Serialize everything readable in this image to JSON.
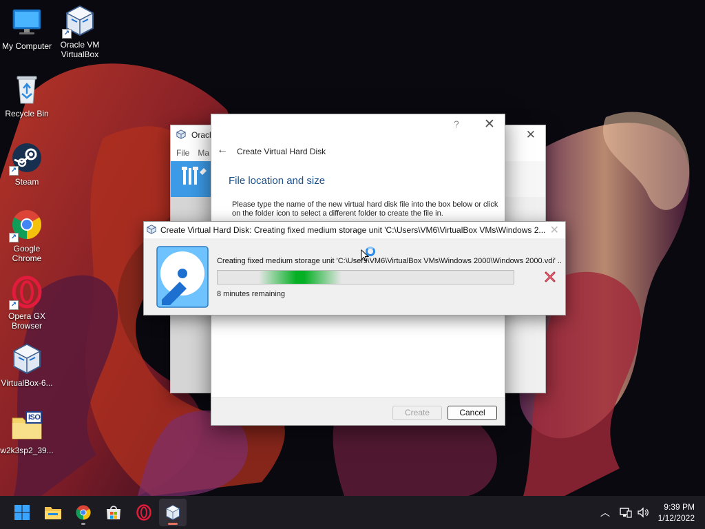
{
  "desktop": {
    "icons": [
      {
        "label": "My Computer",
        "icon": "monitor-icon"
      },
      {
        "label": "Oracle VM VirtualBox",
        "icon": "virtualbox-icon"
      },
      {
        "label": "Recycle Bin",
        "icon": "recycle-bin-icon"
      },
      {
        "label": "Steam",
        "icon": "steam-icon"
      },
      {
        "label": "Google Chrome",
        "icon": "chrome-icon"
      },
      {
        "label": "Opera GX Browser",
        "icon": "opera-gx-icon"
      },
      {
        "label": "VirtualBox-6...",
        "icon": "virtualbox-installer-icon"
      },
      {
        "label": "w2k3sp2_39...",
        "icon": "iso-folder-icon"
      }
    ],
    "iso_badge": "ISO"
  },
  "vbox_main": {
    "title": "Oracle",
    "menu": [
      "File",
      "Ma"
    ]
  },
  "wizard": {
    "help": "?",
    "header": "Create Virtual Hard Disk",
    "subtitle": "File location and size",
    "paragraph": "Please type the name of the new virtual hard disk file into the box below or click on the folder icon to select a different folder to create the file in.",
    "create_label": "Create",
    "cancel_label": "Cancel"
  },
  "progress": {
    "title": "Create Virtual Hard Disk: Creating fixed medium storage unit 'C:\\Users\\VM6\\VirtualBox VMs\\Windows 2...",
    "description": "Creating fixed medium storage unit 'C:\\Users\\VM6\\VirtualBox VMs\\Windows 2000\\Windows 2000.vdi' ...",
    "remaining": "8 minutes remaining",
    "indeterminate": true
  },
  "taskbar": {
    "apps": [
      "start-icon",
      "file-explorer-icon",
      "chrome-icon",
      "microsoft-store-icon",
      "opera-gx-icon",
      "virtualbox-icon"
    ],
    "time": "9:39 PM",
    "date": "1/12/2022"
  },
  "colors": {
    "accent": "#1c4f8a",
    "progress_green": "#06b025",
    "vbox_blue": "#3c9ae6",
    "taskbar": "#1d1b22"
  }
}
